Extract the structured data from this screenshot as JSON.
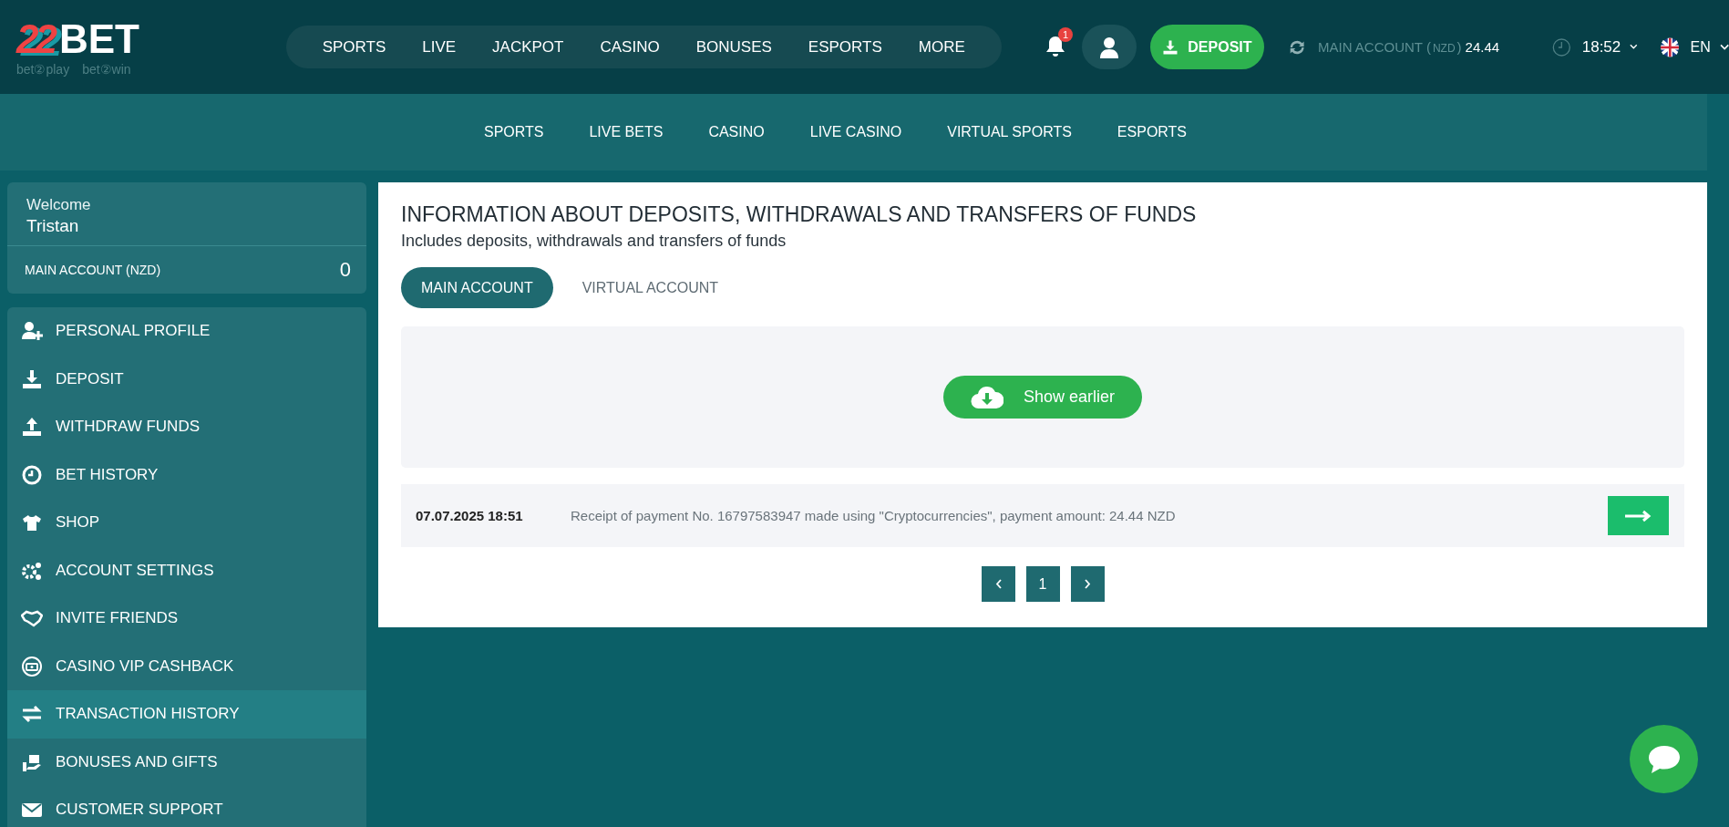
{
  "header": {
    "logo": {
      "digits": "22",
      "word": "BET",
      "tagline_left": "bet②play",
      "tagline_right": "bet②win"
    },
    "nav": [
      "SPORTS",
      "LIVE",
      "JACKPOT",
      "CASINO",
      "BONUSES",
      "ESPORTS",
      "MORE"
    ],
    "notifications_count": "1",
    "deposit_label": "DEPOSIT",
    "balance": {
      "label": "MAIN ACCOUNT (",
      "currency": "NZD",
      "close": ")",
      "amount": "24.44"
    },
    "time": "18:52",
    "language": "EN"
  },
  "subnav": [
    "SPORTS",
    "LIVE BETS",
    "CASINO",
    "LIVE CASINO",
    "VIRTUAL SPORTS",
    "ESPORTS"
  ],
  "sidebar": {
    "welcome": "Welcome",
    "user": "Tristan",
    "account_label": "MAIN ACCOUNT (NZD)",
    "account_balance": "0",
    "items": [
      {
        "label": "PERSONAL PROFILE",
        "selected": false
      },
      {
        "label": "DEPOSIT",
        "selected": false
      },
      {
        "label": "WITHDRAW FUNDS",
        "selected": false
      },
      {
        "label": "BET HISTORY",
        "selected": false
      },
      {
        "label": "SHOP",
        "selected": false
      },
      {
        "label": "ACCOUNT SETTINGS",
        "selected": false
      },
      {
        "label": "INVITE FRIENDS",
        "selected": false
      },
      {
        "label": "CASINO VIP CASHBACK",
        "selected": false
      },
      {
        "label": "TRANSACTION HISTORY",
        "selected": true
      },
      {
        "label": "BONUSES AND GIFTS",
        "selected": false
      },
      {
        "label": "CUSTOMER SUPPORT",
        "selected": false
      }
    ]
  },
  "content": {
    "title": "INFORMATION ABOUT DEPOSITS, WITHDRAWALS AND TRANSFERS OF FUNDS",
    "subtitle": "Includes deposits, withdrawals and transfers of funds",
    "tabs": [
      {
        "label": "MAIN ACCOUNT",
        "selected": true
      },
      {
        "label": "VIRTUAL ACCOUNT",
        "selected": false
      }
    ],
    "show_earlier": "Show earlier",
    "transactions": [
      {
        "date": "07.07.2025 18:51",
        "description": "Receipt of payment No. 16797583947 made using \"Cryptocurrencies\", payment amount: 24.44 NZD"
      }
    ],
    "pages": [
      {
        "label": "1"
      }
    ]
  }
}
